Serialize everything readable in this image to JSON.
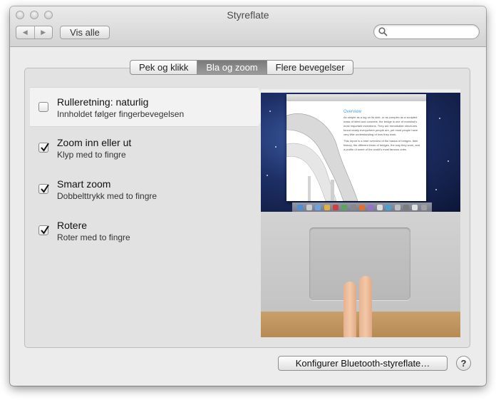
{
  "window": {
    "title": "Styreflate"
  },
  "toolbar": {
    "back_icon": "back-arrow-icon",
    "forward_icon": "forward-arrow-icon",
    "show_all_label": "Vis alle",
    "search_value": "",
    "search_icon": "magnifier-icon"
  },
  "tabs": [
    {
      "label": "Pek og klikk",
      "active": false
    },
    {
      "label": "Bla og zoom",
      "active": true
    },
    {
      "label": "Flere bevegelser",
      "active": false
    }
  ],
  "options": [
    {
      "title": "Rulleretning: naturlig",
      "subtitle": "Innholdet følger fingerbevegelsen",
      "checked": false,
      "selected": true
    },
    {
      "title": "Zoom inn eller ut",
      "subtitle": "Klyp med to fingre",
      "checked": true,
      "selected": false
    },
    {
      "title": "Smart zoom",
      "subtitle": "Dobbelttrykk med to fingre",
      "checked": true,
      "selected": false
    },
    {
      "title": "Rotere",
      "subtitle": "Roter med to fingre",
      "checked": true,
      "selected": false
    }
  ],
  "preview": {
    "doc_heading": "Overview",
    "doc_text": "As simple as a log on its side, or as complex as a sculpted mass of steel and concrete, the bridge is one of mankind's most important inventions. They are remarkable structures found nearly everywhere people are, yet most people have very little understanding of how they work.",
    "doc_text2": "This report is a brief overview of the basics of bridges, their history, the different kinds of bridges, the way they work, and a profile of some of the world's most famous ones."
  },
  "footer": {
    "bluetooth_button_label": "Konfigurer Bluetooth-styreflate…",
    "help_label": "?"
  },
  "colors": {
    "active_tab": "#8a8a8a",
    "window_bg": "#ececec"
  }
}
